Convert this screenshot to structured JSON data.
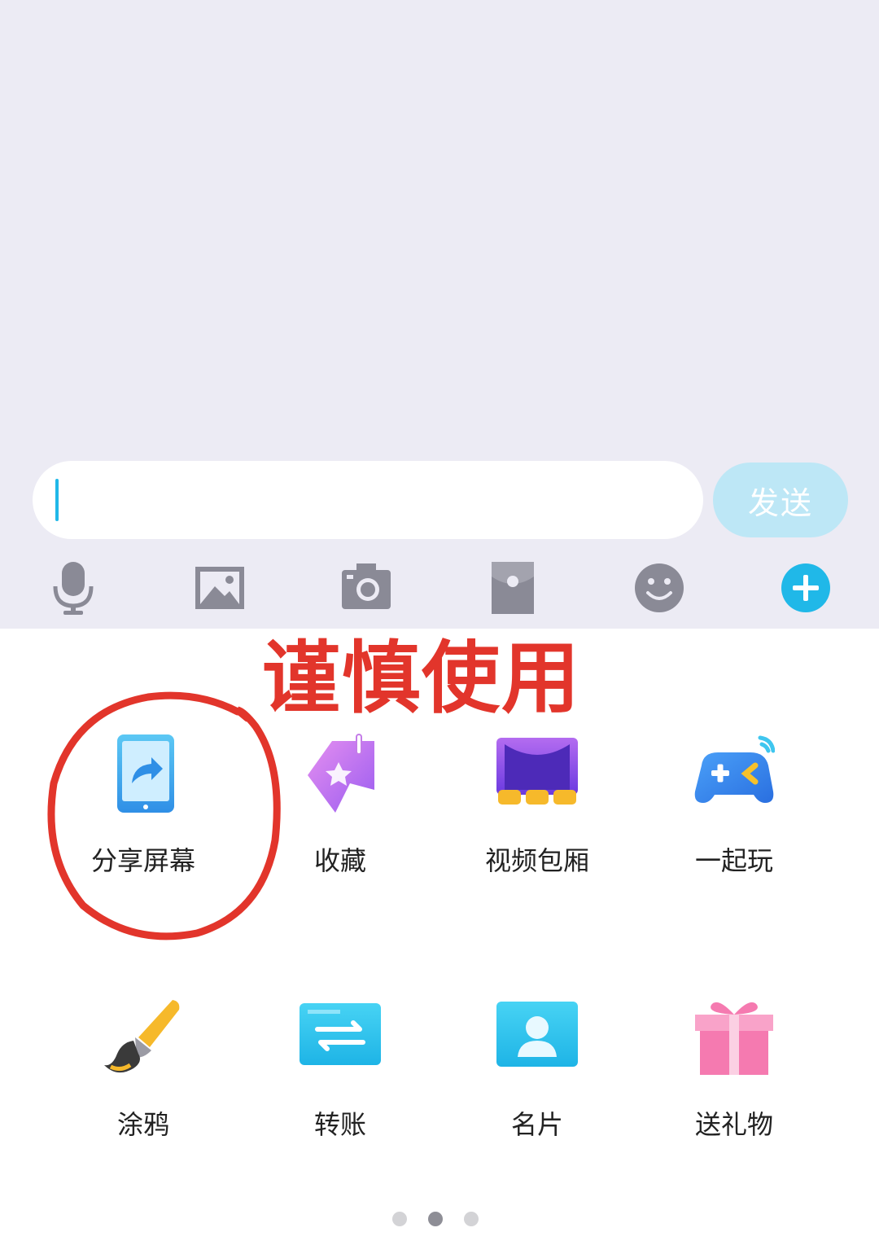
{
  "input": {
    "placeholder": "",
    "value": ""
  },
  "send_button": {
    "label": "发送"
  },
  "toolbar": {
    "icons": [
      "microphone-icon",
      "image-icon",
      "camera-icon",
      "red-packet-icon",
      "emoji-icon",
      "plus-icon"
    ]
  },
  "annotation": {
    "text": "谨慎使用"
  },
  "apps": {
    "row1": [
      {
        "label": "分享屏幕",
        "icon": "share-screen-icon"
      },
      {
        "label": "收藏",
        "icon": "favorites-icon"
      },
      {
        "label": "视频包厢",
        "icon": "video-room-icon"
      },
      {
        "label": "一起玩",
        "icon": "gamepad-icon"
      }
    ],
    "row2": [
      {
        "label": "涂鸦",
        "icon": "paintbrush-icon"
      },
      {
        "label": "转账",
        "icon": "transfer-icon"
      },
      {
        "label": "名片",
        "icon": "business-card-icon"
      },
      {
        "label": "送礼物",
        "icon": "gift-icon"
      }
    ]
  },
  "pagination": {
    "pages": 3,
    "current": 2
  },
  "colors": {
    "accent": "#20b8e8",
    "send_disabled": "#bde7f6",
    "annotation": "#e2352b",
    "chat_bg": "#ecebf4",
    "toolbar_icon": "#8a8a96"
  }
}
